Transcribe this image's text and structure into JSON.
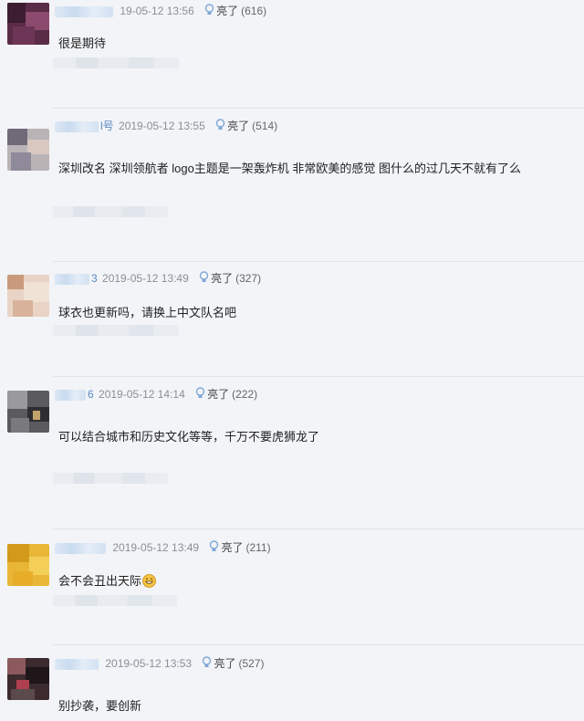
{
  "like_label": "亮了",
  "comments": [
    {
      "name_tail": "",
      "time": "19-05-12 13:56",
      "likes": "(616)",
      "text": "很是期待"
    },
    {
      "name_tail": "l号",
      "time": "2019-05-12 13:55",
      "likes": "(514)",
      "text": "深圳改名 深圳领航者 logo主题是一架轰炸机 非常欧美的感觉 图什么的过几天不就有了么"
    },
    {
      "name_tail": "3",
      "time": "2019-05-12 13:49",
      "likes": "(327)",
      "text": "球衣也更新吗，请换上中文队名吧"
    },
    {
      "name_tail": "6",
      "time": "2019-05-12 14:14",
      "likes": "(222)",
      "text": "可以结合城市和历史文化等等，千万不要虎狮龙了"
    },
    {
      "name_tail": "",
      "time": "2019-05-12 13:49",
      "likes": "(211)",
      "text": "会不会丑出天际"
    },
    {
      "name_tail": "",
      "time": "2019-05-12 13:53",
      "likes": "(527)",
      "text": "别抄袭，要创新"
    }
  ],
  "icons": {
    "like": "lightbulb-icon",
    "emoji": "grin-emoji-icon"
  }
}
